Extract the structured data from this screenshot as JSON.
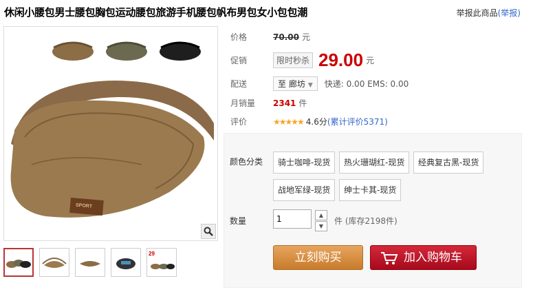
{
  "product": {
    "title": "休闲小腰包男士腰包胸包运动腰包旅游手机腰包帆布男包女小包包潮",
    "report_prefix": "举报此商品",
    "report_link": "(举报)"
  },
  "price": {
    "label": "价格",
    "original": "70.00",
    "unit": "元"
  },
  "promo": {
    "label": "促销",
    "tag": "限时秒杀",
    "price": "29.00",
    "unit": "元"
  },
  "delivery": {
    "label": "配送",
    "destination": "至 廊坊",
    "shipping": "快递: 0.00 EMS: 0.00"
  },
  "sales": {
    "label": "月销量",
    "count": "2341",
    "unit": "件"
  },
  "rating": {
    "label": "评价",
    "stars": "★★★★★",
    "score": "4.6分",
    "reviews_link": "(累计评价5371)",
    "score_value": 4.6
  },
  "sku": {
    "color_label": "颜色分类",
    "options": [
      "骑士咖啡-现货",
      "热火珊瑚红-现货",
      "经典复古黑-现货",
      "战地军绿-现货",
      "绅士卡其-现货"
    ],
    "qty_label": "数量",
    "qty_value": "1",
    "stock_text": "件 (库存2198件)"
  },
  "actions": {
    "buy_now": "立刻购买",
    "add_to_cart": "加入购物车"
  },
  "thumb_badge": "29",
  "icons": {
    "zoom": "magnifier-icon",
    "cart": "shopping-cart-icon",
    "up": "chevron-up-icon",
    "down": "chevron-down-icon"
  },
  "colors": {
    "price_red": "#cc0000",
    "buy_orange": "#d98c3f",
    "cart_red": "#c0182a",
    "link_blue": "#3366cc",
    "star_gold": "#f5a623"
  }
}
